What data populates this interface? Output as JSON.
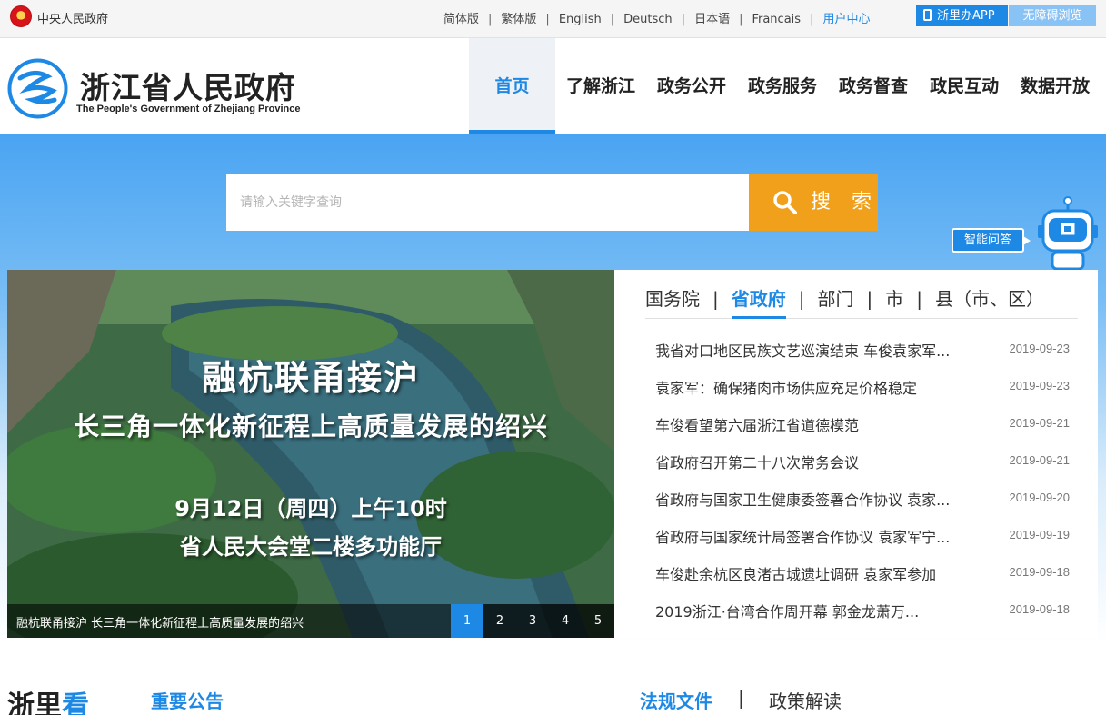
{
  "topbar": {
    "central_gov": "中央人民政府",
    "languages": [
      "简体版",
      "繁体版",
      "English",
      "Deutsch",
      "日本语",
      "Francais"
    ],
    "user_center": "用户中心",
    "app_button": "浙里办APP",
    "accessibility_button": "无障碍浏览"
  },
  "header": {
    "logo_cn": "浙江省人民政府",
    "logo_en": "The People's Government of Zhejiang Province",
    "nav": [
      "首页",
      "了解浙江",
      "政务公开",
      "政务服务",
      "政务督查",
      "政民互动",
      "数据开放"
    ],
    "active_nav": "首页"
  },
  "search": {
    "placeholder": "请输入关键字查询",
    "button_label": "搜 索"
  },
  "assistant": {
    "label": "智能问答"
  },
  "carousel": {
    "line1": "融杭联甬接沪",
    "line2": "长三角一体化新征程上高质量发展的绍兴",
    "line3": "9月12日（周四）上午10时",
    "line4": "省人民大会堂二楼多功能厅",
    "caption": "融杭联甬接沪 长三角一体化新征程上高质量发展的绍兴",
    "pages": [
      "1",
      "2",
      "3",
      "4",
      "5"
    ],
    "active_page": "1"
  },
  "news": {
    "tabs": [
      "国务院",
      "省政府",
      "部门",
      "市",
      "县（市、区）"
    ],
    "active_tab": "省政府",
    "items": [
      {
        "title": "我省对口地区民族文艺巡演结束 车俊袁家军...",
        "date": "2019-09-23"
      },
      {
        "title": "袁家军：确保猪肉市场供应充足价格稳定",
        "date": "2019-09-23"
      },
      {
        "title": "车俊看望第六届浙江省道德模范",
        "date": "2019-09-21"
      },
      {
        "title": "省政府召开第二十八次常务会议",
        "date": "2019-09-21"
      },
      {
        "title": "省政府与国家卫生健康委签署合作协议 袁家...",
        "date": "2019-09-20"
      },
      {
        "title": "省政府与国家统计局签署合作协议 袁家军宁...",
        "date": "2019-09-19"
      },
      {
        "title": "车俊赴余杭区良渚古城遗址调研 袁家军参加",
        "date": "2019-09-18"
      },
      {
        "title": "2019浙江·台湾合作周开幕 郭金龙萧万...",
        "date": "2019-09-18"
      }
    ]
  },
  "bottom": {
    "title_a": "浙里",
    "title_b": "看",
    "notice": "重要公告",
    "laws": "法规文件",
    "separator": "|",
    "policy": "政策解读"
  },
  "colors": {
    "accent": "#1e88e5",
    "search_button": "#f0a01b"
  },
  "icons": [
    "national-emblem-icon",
    "phone-icon",
    "search-icon",
    "robot-icon"
  ]
}
